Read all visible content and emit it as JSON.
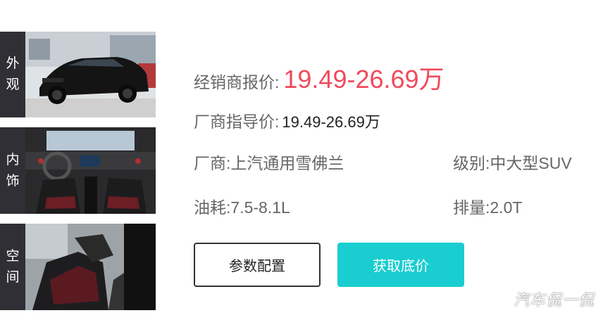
{
  "thumbnails": [
    {
      "label_line1": "外",
      "label_line2": "观"
    },
    {
      "label_line1": "内",
      "label_line2": "饰"
    },
    {
      "label_line1": "空",
      "label_line2": "间"
    }
  ],
  "info": {
    "dealer_price_label": "经销商报价:",
    "dealer_price_value": "19.49-26.69万",
    "guide_price_label": "厂商指导价:",
    "guide_price_value": "19.49-26.69万",
    "maker_label": "厂商:",
    "maker_value": "上汽通用雪佛兰",
    "level_label": "级别:",
    "level_value": "中大型SUV",
    "fuel_label": "油耗:",
    "fuel_value": "7.5-8.1L",
    "displacement_label": "排量:",
    "displacement_value": "2.0T"
  },
  "buttons": {
    "config_label": "参数配置",
    "price_label": "获取底价"
  },
  "watermark": "汽车侃一侃",
  "colors": {
    "dealer_price": "#f04a5c",
    "accent_button": "#19cdd0",
    "label_bg": "#2f2f35"
  }
}
